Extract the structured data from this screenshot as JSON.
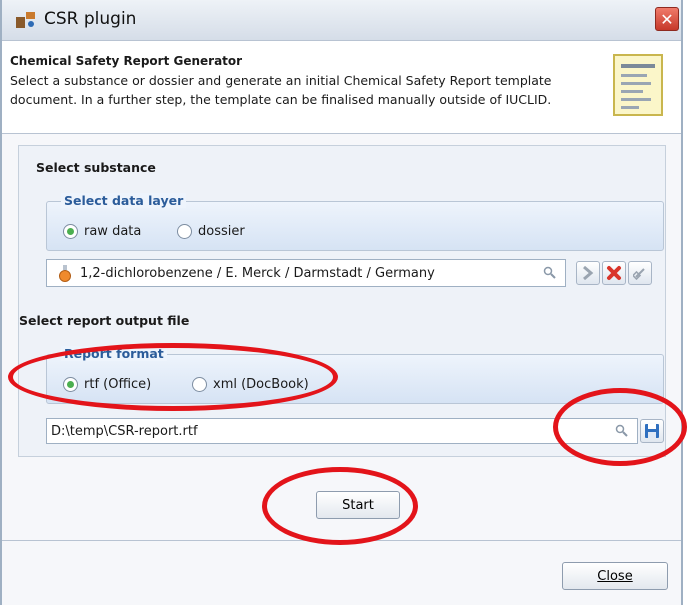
{
  "window": {
    "title": "CSR plugin",
    "close_glyph": "✕"
  },
  "header": {
    "title": "Chemical Safety Report Generator",
    "description": "Select a substance or dossier and generate an initial Chemical Safety Report template document. In a further step, the template can be finalised manually outside of IUCLID."
  },
  "select_substance": {
    "label": "Select substance",
    "data_layer": {
      "title": "Select data layer",
      "options": [
        "raw data",
        "dossier"
      ],
      "selected": "raw data"
    },
    "substance_value": "1,2-dichlorobenzene / E. Merck / Darmstadt / Germany"
  },
  "report_output": {
    "label": "Select report output file",
    "format": {
      "title": "Report format",
      "options": [
        "rtf (Office)",
        "xml (DocBook)"
      ],
      "selected": "rtf (Office)"
    },
    "path_value": "D:\\temp\\CSR-report.rtf"
  },
  "buttons": {
    "start": "Start",
    "close": "Close"
  },
  "colors": {
    "annotation": "#e3141a",
    "radio_selected": "#4caf50",
    "group_title": "#2b5c9a"
  }
}
